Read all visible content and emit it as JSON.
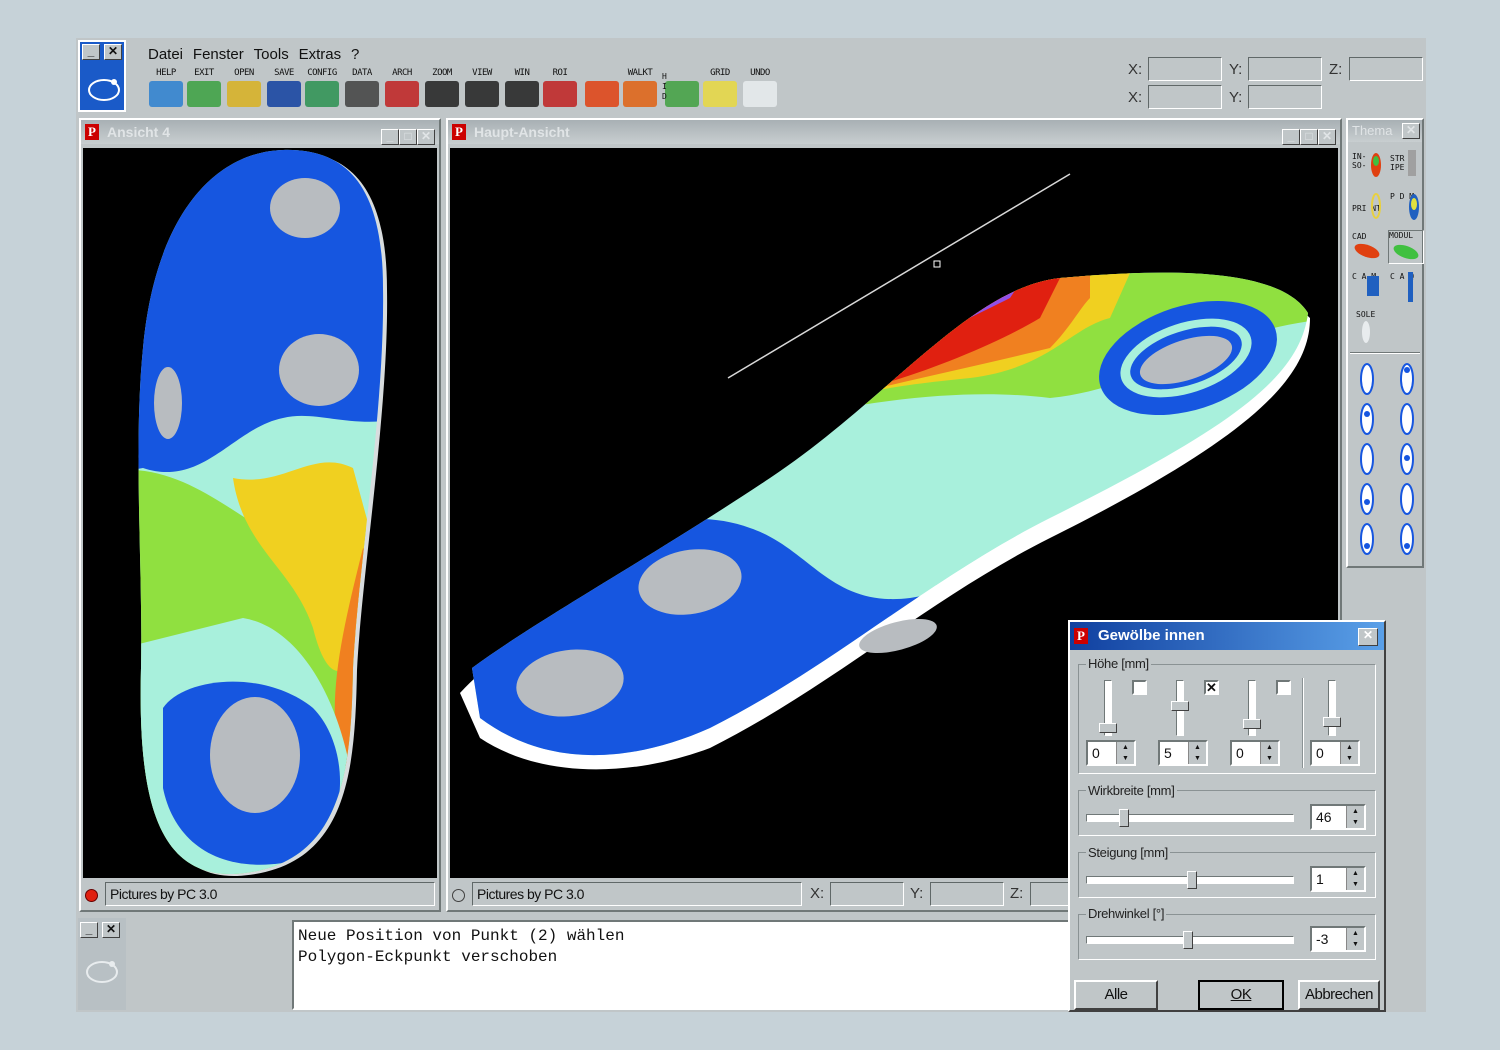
{
  "menu": [
    "Datei",
    "Fenster",
    "Tools",
    "Extras",
    "?"
  ],
  "toolbar": [
    {
      "label": "HELP",
      "icon": "pedcad-icon",
      "color": "#2a7fd0"
    },
    {
      "label": "EXIT",
      "icon": "exit-icon",
      "color": "#3aa040"
    },
    {
      "label": "OPEN",
      "icon": "open-folder-icon",
      "color": "#d8b020"
    },
    {
      "label": "SAVE",
      "icon": "save-disk-icon",
      "color": "#1040a0"
    },
    {
      "label": "CONFIG",
      "icon": "config-folder-icon",
      "color": "#2a9050"
    },
    {
      "label": "DATA",
      "icon": "data-list-icon",
      "color": "#404040"
    },
    {
      "label": "ARCH",
      "icon": "archive-icon",
      "color": "#c02020"
    },
    {
      "label": "ZOOM",
      "icon": "zoom-magnifier-icon",
      "color": "#202020"
    },
    {
      "label": "VIEW",
      "icon": "view-glasses-icon",
      "color": "#202020"
    },
    {
      "label": "WIN",
      "icon": "window-layout-icon",
      "color": "#202020"
    },
    {
      "label": "ROI",
      "icon": "roi-target-icon",
      "color": "#c02020"
    },
    {
      "label": "",
      "icon": "insole-colormap-icon",
      "color": "#e04010"
    },
    {
      "label": "WALKT",
      "icon": "walk-colormap-icon",
      "color": "#e06010"
    },
    {
      "label": "",
      "icon": "hid-foot-icon",
      "color": "#40a040"
    },
    {
      "label": "GRID",
      "icon": "grid-icon",
      "color": "#e8d840"
    },
    {
      "label": "UNDO",
      "icon": "undo-arrow-icon",
      "color": "#e8ecee"
    }
  ],
  "toolbar_hid_letters": "H I D",
  "coords": {
    "x": "X:",
    "y": "Y:",
    "z": "Z:"
  },
  "windows": {
    "left": {
      "title": "Ansicht 4",
      "status": "Pictures by PC 3.0"
    },
    "main": {
      "title": "Haupt-Ansicht",
      "status": "Pictures by PC 3.0"
    }
  },
  "theme": {
    "title": "Thema",
    "items": [
      "IN- SO- LE",
      "STR IPE",
      "PRI NT",
      "P D M",
      "CAD",
      "MODUL",
      "C A M",
      "C A Q",
      "SOLE"
    ]
  },
  "console": {
    "lines": [
      "Neue Position von Punkt (2) wählen",
      "Polygon-Eckpunkt verschoben"
    ]
  },
  "dialog": {
    "title": "Gewölbe innen",
    "height_group": "Höhe [mm]",
    "height_values": [
      "0",
      "5",
      "0",
      "0"
    ],
    "height_checks": [
      false,
      true,
      false
    ],
    "width_label": "Wirkbreite [mm]",
    "width_value": "46",
    "slope_label": "Steigung [mm]",
    "slope_value": "1",
    "rotation_label": "Drehwinkel [°]",
    "rotation_value": "-3",
    "buttons": {
      "all": "Alle",
      "ok": "OK",
      "cancel": "Abbrechen"
    }
  },
  "colors": {
    "background": "#c6d2d8",
    "viewport": "#000000",
    "heat_blue": "#1656e0",
    "heat_cyan": "#a8f0dc",
    "heat_green": "#90e040",
    "heat_yellow": "#f0d020",
    "heat_orange": "#f08020",
    "heat_red": "#e02010",
    "heat_purple": "#9050e8",
    "pad_gray": "#b8bcc0"
  }
}
